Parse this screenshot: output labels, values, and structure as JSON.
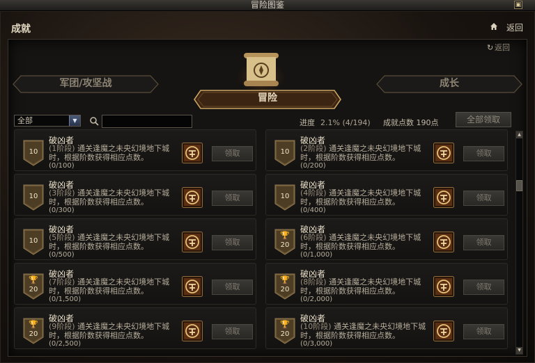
{
  "window": {
    "title": "冒险图鉴",
    "min_icon": "minimize-icon"
  },
  "header": {
    "title": "成就",
    "back_label": "返回",
    "home_icon": "home-icon"
  },
  "panel": {
    "back_label": "返回"
  },
  "tabs": [
    {
      "label": "军团/攻坚战",
      "active": false
    },
    {
      "label": "冒险",
      "active": true
    },
    {
      "label": "成长",
      "active": false
    }
  ],
  "filter": {
    "selected": "全部",
    "search_value": ""
  },
  "stats": {
    "progress_label": "进度",
    "progress_value": "2.1% (4/194)",
    "points_text": "成就点数 190点"
  },
  "claim_all_label": "全部领取",
  "achievements": [
    {
      "name": "破凶者",
      "stage": "(1阶段)",
      "desc": "通关逢魔之未央幻境地下城时，根据阶数获得相应点数。",
      "progress": "(0/100)",
      "points": "10",
      "trophy": false,
      "claim_label": "领取"
    },
    {
      "name": "破凶者",
      "stage": "(2阶段)",
      "desc": "通关逢魔之未央幻境地下城时，根据阶数获得相应点数。",
      "progress": "(0/200)",
      "points": "10",
      "trophy": false,
      "claim_label": "领取"
    },
    {
      "name": "破凶者",
      "stage": "(3阶段)",
      "desc": "通关逢魔之未央幻境地下城时，根据阶数获得相应点数。",
      "progress": "(0/300)",
      "points": "10",
      "trophy": false,
      "claim_label": "领取"
    },
    {
      "name": "破凶者",
      "stage": "(4阶段)",
      "desc": "通关逢魔之未央幻境地下城时，根据阶数获得相应点数。",
      "progress": "(0/400)",
      "points": "10",
      "trophy": false,
      "claim_label": "领取"
    },
    {
      "name": "破凶者",
      "stage": "(5阶段)",
      "desc": "通关逢魔之未央幻境地下城时，根据阶数获得相应点数。",
      "progress": "(0/500)",
      "points": "10",
      "trophy": false,
      "claim_label": "领取"
    },
    {
      "name": "破凶者",
      "stage": "(6阶段)",
      "desc": "通关逢魔之未央幻境地下城时，根据阶数获得相应点数。",
      "progress": "(0/1,000)",
      "points": "20",
      "trophy": true,
      "claim_label": "领取"
    },
    {
      "name": "破凶者",
      "stage": "(7阶段)",
      "desc": "通关逢魔之未央幻境地下城时，根据阶数获得相应点数。",
      "progress": "(0/1,500)",
      "points": "20",
      "trophy": true,
      "claim_label": "领取"
    },
    {
      "name": "破凶者",
      "stage": "(8阶段)",
      "desc": "通关逢魔之未央幻境地下城时，根据阶数获得相应点数。",
      "progress": "(0/2,000)",
      "points": "20",
      "trophy": true,
      "claim_label": "领取"
    },
    {
      "name": "破凶者",
      "stage": "(9阶段)",
      "desc": "通关逢魔之未央幻境地下城时，根据阶数获得相应点数。",
      "progress": "(0/2,500)",
      "points": "20",
      "trophy": true,
      "claim_label": "领取"
    },
    {
      "name": "破凶者",
      "stage": "(10阶段)",
      "desc": "通关逢魔之未央幻境地下城时，根据阶数获得相应点数。",
      "progress": "(0/3,000)",
      "points": "20",
      "trophy": true,
      "claim_label": "领取"
    }
  ],
  "colors": {
    "accent_gold": "#c9a464",
    "text_light": "#ece2cc",
    "panel_bg": "#151412"
  }
}
